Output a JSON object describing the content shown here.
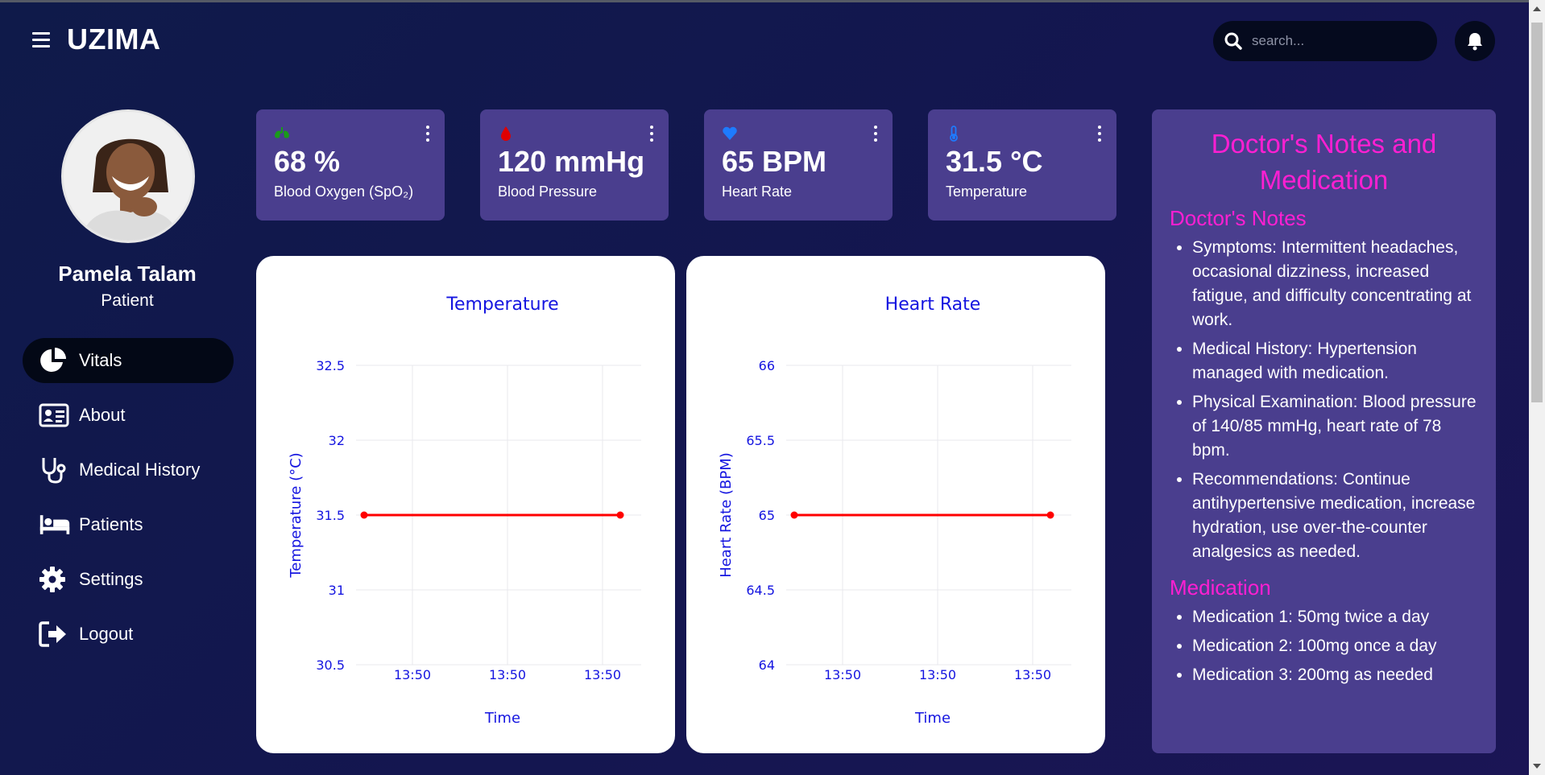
{
  "header": {
    "app_title": "UZIMA",
    "search_placeholder": "search..."
  },
  "user": {
    "name": "Pamela Talam",
    "role": "Patient"
  },
  "sidebar": {
    "items": [
      {
        "label": "Vitals",
        "icon": "pie-chart-icon",
        "active": true
      },
      {
        "label": "About",
        "icon": "id-card-icon",
        "active": false
      },
      {
        "label": "Medical History",
        "icon": "stethoscope-icon",
        "active": false
      },
      {
        "label": "Patients",
        "icon": "bed-icon",
        "active": false
      },
      {
        "label": "Settings",
        "icon": "gear-icon",
        "active": false
      },
      {
        "label": "Logout",
        "icon": "logout-icon",
        "active": false
      }
    ]
  },
  "stats": [
    {
      "value": "68 %",
      "label": "Blood Oxygen (SpO₂)",
      "icon": "lungs-icon",
      "color": "#1a9b1a"
    },
    {
      "value": "120 mmHg",
      "label": "Blood Pressure",
      "icon": "blood-drop-icon",
      "color": "#e00000"
    },
    {
      "value": "65 BPM",
      "label": "Heart Rate",
      "icon": "heart-icon",
      "color": "#1e7bff"
    },
    {
      "value": "31.5 °C",
      "label": "Temperature",
      "icon": "thermometer-icon",
      "color": "#1e7bff"
    }
  ],
  "chart_data": [
    {
      "type": "line",
      "title": "Temperature",
      "xlabel": "Time",
      "ylabel": "Temperature (°C)",
      "ylim": [
        30.5,
        32.5
      ],
      "yticks": [
        "32.5",
        "32",
        "31.5",
        "31",
        "30.5"
      ],
      "xticks": [
        "13:50",
        "13:50",
        "13:50"
      ],
      "series": [
        {
          "values": [
            31.5,
            31.5
          ],
          "color": "#ff0000"
        }
      ],
      "grid": true
    },
    {
      "type": "line",
      "title": "Heart Rate",
      "xlabel": "Time",
      "ylabel": "Heart Rate (BPM)",
      "ylim": [
        64,
        66
      ],
      "yticks": [
        "66",
        "65.5",
        "65",
        "64.5",
        "64"
      ],
      "xticks": [
        "13:50",
        "13:50",
        "13:50"
      ],
      "series": [
        {
          "values": [
            65,
            65
          ],
          "color": "#ff0000"
        }
      ],
      "grid": true
    }
  ],
  "notes": {
    "title": "Doctor's Notes and Medication",
    "doctor_notes_heading": "Doctor's Notes",
    "doctor_notes": [
      "Symptoms: Intermittent headaches, occasional dizziness, increased fatigue, and difficulty concentrating at work.",
      "Medical History: Hypertension managed with medication.",
      "Physical Examination: Blood pressure of 140/85 mmHg, heart rate of 78 bpm.",
      "Recommendations: Continue antihypertensive medication, increase hydration, use over-the-counter analgesics as needed."
    ],
    "medication_heading": "Medication",
    "medications": [
      "Medication 1: 50mg twice a day",
      "Medication 2: 100mg once a day",
      "Medication 3: 200mg as needed"
    ]
  }
}
